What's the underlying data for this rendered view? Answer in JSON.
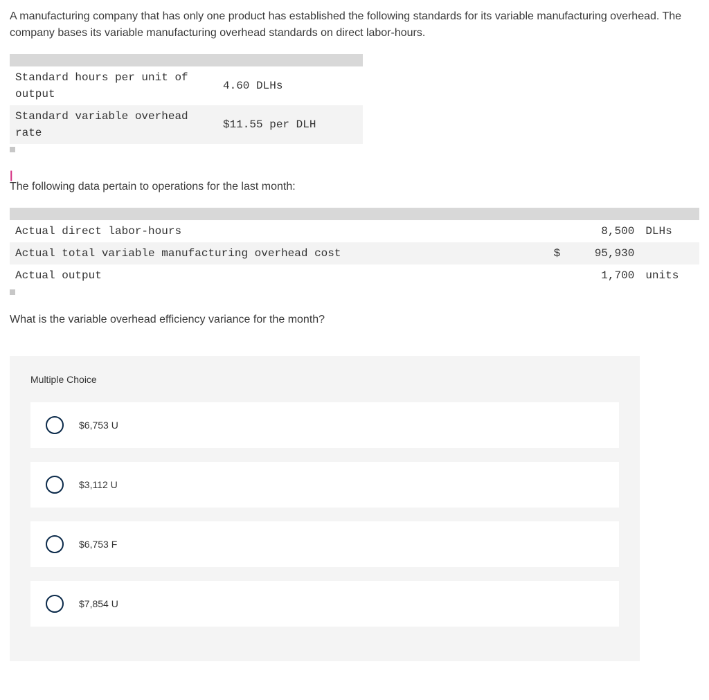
{
  "intro": "A manufacturing company that has only one product has established the following standards for its variable manufacturing overhead. The company bases its variable manufacturing overhead standards on direct labor-hours.",
  "standards": {
    "rows": [
      {
        "label": "Standard hours per unit of output",
        "value": "4.60 DLHs"
      },
      {
        "label": "Standard variable overhead rate",
        "value": "$11.55 per DLH"
      }
    ]
  },
  "sub_intro": "The following data pertain to operations for the last month:",
  "operations": {
    "rows": [
      {
        "label": "Actual direct labor-hours",
        "currency": "",
        "num": "8,500",
        "unit": "DLHs"
      },
      {
        "label": "Actual total variable manufacturing overhead cost",
        "currency": "$",
        "num": "95,930",
        "unit": ""
      },
      {
        "label": "Actual output",
        "currency": "",
        "num": "1,700",
        "unit": "units"
      }
    ]
  },
  "question": "What is the variable overhead efficiency variance for the month?",
  "mc_title": "Multiple Choice",
  "choices": [
    {
      "label": "$6,753 U"
    },
    {
      "label": "$3,112 U"
    },
    {
      "label": "$6,753 F"
    },
    {
      "label": "$7,854 U"
    }
  ]
}
